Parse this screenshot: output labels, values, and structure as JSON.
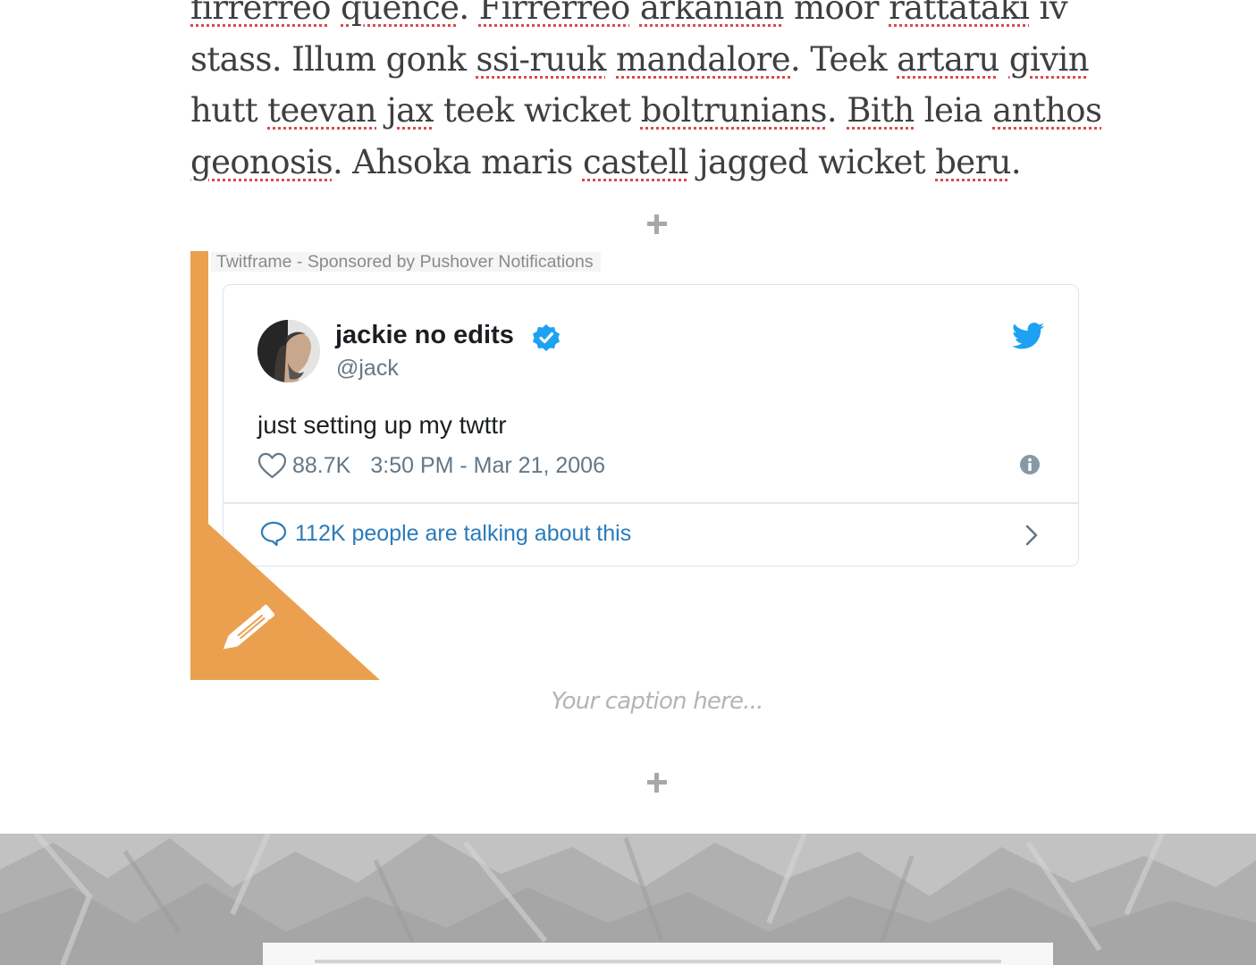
{
  "article": {
    "lines": [
      [
        {
          "t": "firrerreo",
          "s": true
        },
        {
          "t": " "
        },
        {
          "t": "quence",
          "s": true
        },
        {
          "t": ". "
        },
        {
          "t": "Firrerreo",
          "s": true
        },
        {
          "t": " "
        },
        {
          "t": "arkanian",
          "s": true
        },
        {
          "t": " moor "
        },
        {
          "t": "rattataki",
          "s": true
        },
        {
          "t": " iv"
        }
      ],
      [
        {
          "t": "stass. Illum gonk "
        },
        {
          "t": "ssi-ruuk",
          "s": true
        },
        {
          "t": " "
        },
        {
          "t": "mandalore",
          "s": true
        },
        {
          "t": ". Teek "
        },
        {
          "t": "artaru",
          "s": true
        },
        {
          "t": " "
        },
        {
          "t": "givin",
          "s": true
        }
      ],
      [
        {
          "t": "hutt "
        },
        {
          "t": "teevan",
          "s": true
        },
        {
          "t": " "
        },
        {
          "t": "jax",
          "s": true
        },
        {
          "t": " teek wicket "
        },
        {
          "t": "boltrunians",
          "s": true
        },
        {
          "t": ". "
        },
        {
          "t": "Bith",
          "s": true
        },
        {
          "t": " leia "
        },
        {
          "t": "anthos",
          "s": true
        }
      ],
      [
        {
          "t": "geonosis",
          "s": true
        },
        {
          "t": ". Ahsoka maris "
        },
        {
          "t": "castell",
          "s": true
        },
        {
          "t": " jagged wicket "
        },
        {
          "t": "beru",
          "s": true
        },
        {
          "t": "."
        }
      ]
    ]
  },
  "embed": {
    "label": "Twitframe - Sponsored by Pushover Notifications",
    "accent_color": "#eba050"
  },
  "tweet": {
    "display_name": "jackie no edits",
    "handle": "@jack",
    "text": "just setting up my twttr",
    "likes": "88.7K",
    "timestamp": "3:50 PM - Mar 21, 2006",
    "talking": "112K people are talking about this",
    "icons": {
      "verified": "verified-badge-icon",
      "brand": "twitter-bird-icon",
      "like": "heart-icon",
      "info": "info-icon",
      "reply": "speech-bubble-icon",
      "more": "chevron-right-icon",
      "edit": "pencil-icon"
    },
    "link_color": "#2b7bb9",
    "brand_color": "#1da1f2"
  },
  "caption": {
    "placeholder": "Your caption here..."
  }
}
